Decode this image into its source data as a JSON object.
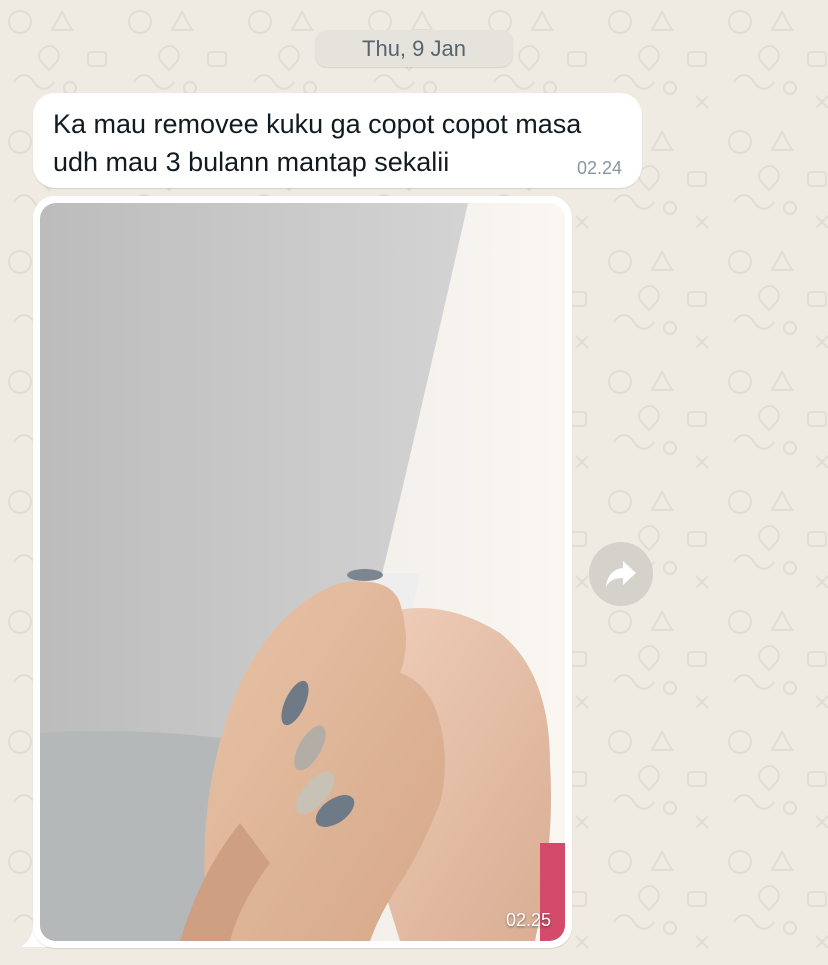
{
  "chat": {
    "date_label": "Thu, 9 Jan",
    "messages": [
      {
        "type": "text",
        "text": "Ka mau removee kuku ga copot copot masa udh mau 3 bulann mantap sekalii",
        "time": "02.24"
      },
      {
        "type": "image",
        "time": "02.25"
      }
    ]
  },
  "icons": {
    "forward": "forward-arrow-icon"
  },
  "colors": {
    "background": "#efeae2",
    "bubble": "#ffffff",
    "date_chip": "#e6e3dc",
    "forward_button": "#d5d2cb",
    "timestamp": "#8696a0"
  }
}
